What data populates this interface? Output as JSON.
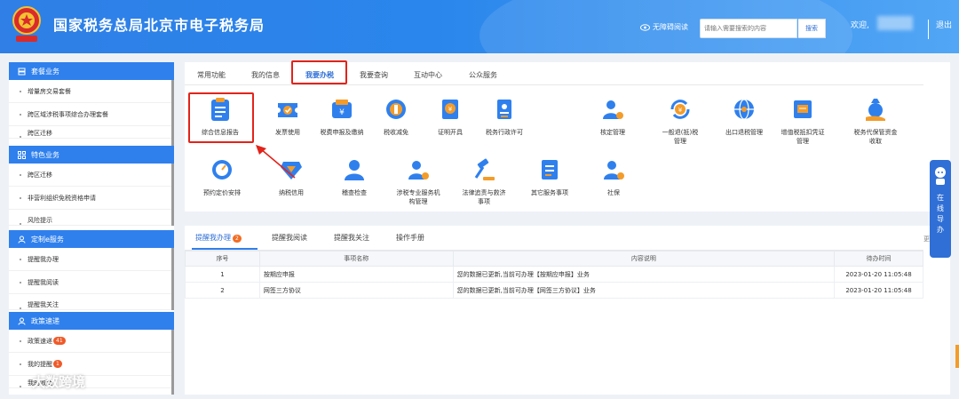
{
  "header": {
    "title": "国家税务总局北京市电子税务局",
    "accessibility": "无障碍阅读",
    "search_placeholder": "请输入需要搜索的内容",
    "search_button": "搜索",
    "welcome": "欢迎,",
    "logout": "退出"
  },
  "sidebar": {
    "groups": [
      {
        "title": "套餐业务",
        "items": [
          "增量房交易套餐",
          "跨区域涉税事项综合办理套餐",
          "跨区迁移"
        ]
      },
      {
        "title": "特色业务",
        "items": [
          "跨区迁移",
          "非营利组织免税资格申请",
          "风险提示"
        ]
      },
      {
        "title": "定制e服务",
        "items": [
          "提醒我办理",
          "提醒我阅读",
          "提醒我关注"
        ]
      },
      {
        "title": "政策速递",
        "items": [
          "政策速递",
          "我的提醒",
          "我的收藏"
        ]
      }
    ],
    "badges": {
      "policy": "41",
      "reminder": "1"
    }
  },
  "tabs": [
    "常用功能",
    "我的信息",
    "我要办税",
    "我要查询",
    "互动中心",
    "公众服务"
  ],
  "functions": [
    "综合信息报告",
    "发票使用",
    "税费申报及缴纳",
    "税收减免",
    "证明开具",
    "税务行政许可",
    "核定管理",
    "一般退(抵)税",
    "管理",
    "出口退税管理",
    "增值税抵扣凭证",
    "管理",
    "税务代保管资金",
    "收取",
    "预约定价安排",
    "纳税信用",
    "稽查检查",
    "涉税专业服务机",
    "构管理",
    "法律追责与救济",
    "事项",
    "其它服务事项",
    "社保"
  ],
  "lower_tabs": {
    "remind_do": "提醒我办理",
    "remind_read": "提醒我阅读",
    "remind_follow": "提醒我关注",
    "manual": "操作手册",
    "count": "2",
    "more": "更"
  },
  "table": {
    "headers": [
      "序号",
      "事项名称",
      "内容说明",
      "待办时间"
    ],
    "rows": [
      {
        "no": "1",
        "name": "按期应申报",
        "desc": "您的数据已更新,当前可办理【按期应申报】业务",
        "time": "2023-01-20 11:05:48"
      },
      {
        "no": "2",
        "name": "网签三方协议",
        "desc": "您的数据已更新,当前可办理【网签三方协议】业务",
        "time": "2023-01-20 11:05:48"
      }
    ]
  },
  "float_help": "在线导办",
  "watermark": "大数跨境",
  "colors": {
    "brand": "#2f80ed",
    "header": "#2f7fe6",
    "highlight": "#e2231a",
    "badge": "#f36d24"
  }
}
